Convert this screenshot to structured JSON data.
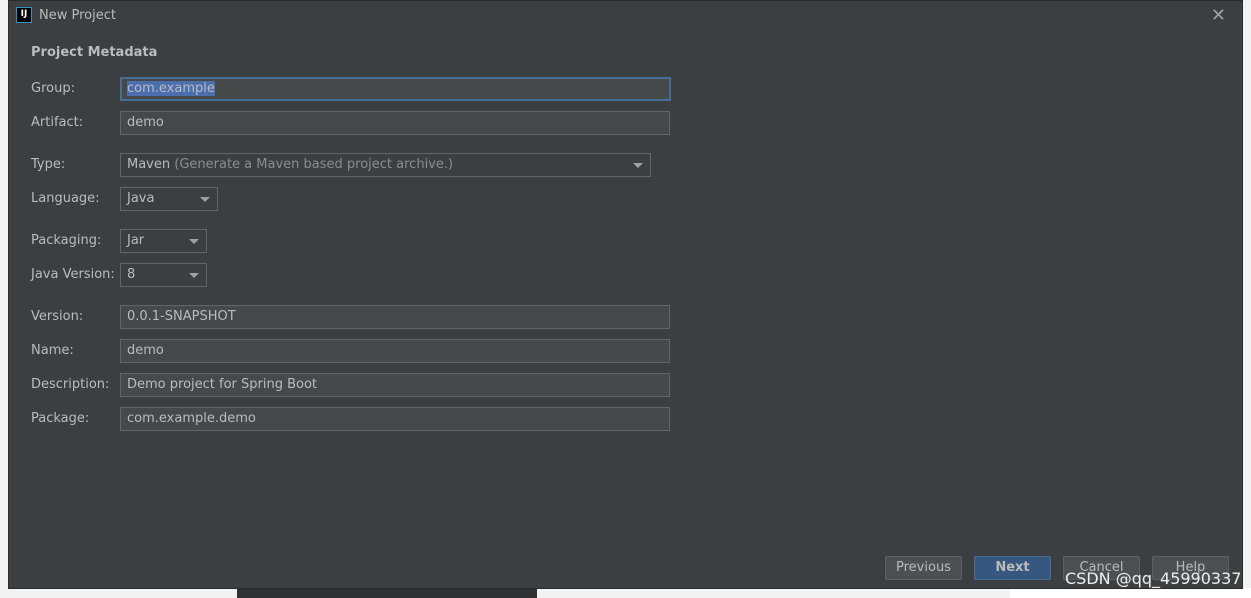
{
  "window": {
    "title": "New Project",
    "icon": "intellij-idea-icon"
  },
  "section_title": "Project Metadata",
  "fields": {
    "group": {
      "label": "Group:",
      "value": "com.example"
    },
    "artifact": {
      "label": "Artifact:",
      "value": "demo"
    },
    "type": {
      "label": "Type:",
      "value": "Maven",
      "hint": "(Generate a Maven based project archive.)"
    },
    "language": {
      "label": "Language:",
      "value": "Java"
    },
    "packaging": {
      "label": "Packaging:",
      "value": "Jar"
    },
    "java_version": {
      "label": "Java Version:",
      "value": "8"
    },
    "version": {
      "label": "Version:",
      "value": "0.0.1-SNAPSHOT"
    },
    "name": {
      "label": "Name:",
      "value": "demo"
    },
    "description": {
      "label": "Description:",
      "value": "Demo project for Spring Boot"
    },
    "package": {
      "label": "Package:",
      "value": "com.example.demo"
    }
  },
  "buttons": {
    "previous": "Previous",
    "next": "Next",
    "cancel": "Cancel",
    "help": "Help"
  },
  "watermark": "CSDN @qq_45990337",
  "colors": {
    "dialog_bg": "#3c3f41",
    "field_bg": "#45494a",
    "default_button": "#365880",
    "focus_border": "#466d94"
  }
}
